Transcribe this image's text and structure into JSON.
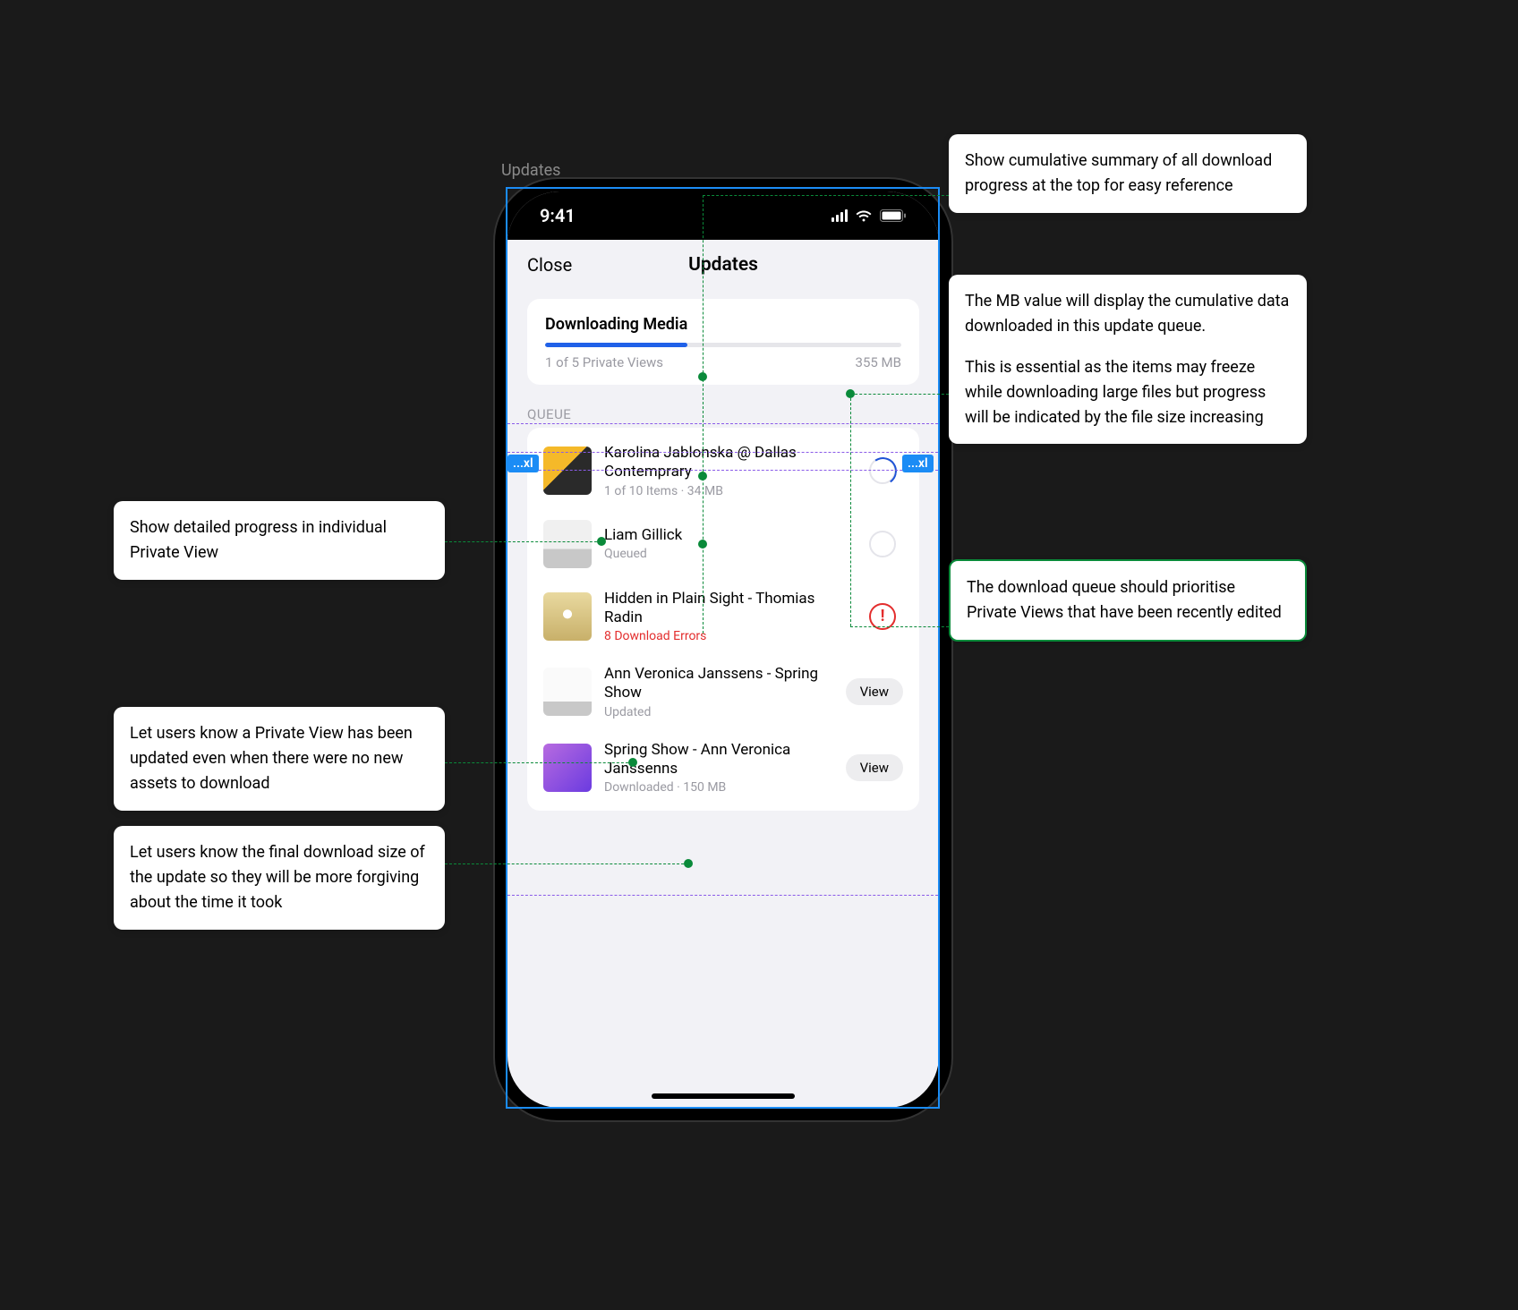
{
  "canvas_label": "Updates",
  "status": {
    "time": "9:41"
  },
  "nav": {
    "close": "Close",
    "title": "Updates"
  },
  "summary": {
    "title": "Downloading Media",
    "views_text": "1 of 5 Private Views",
    "mb_text": "355 MB",
    "progress_pct": 40
  },
  "section": {
    "queue_label": "QUEUE"
  },
  "queue": [
    {
      "title": "Karolina Jablonska @ Dallas Contemprary",
      "sub": "1 of 10 Items · 34 MB",
      "trail": "spinner"
    },
    {
      "title": "Liam Gillick",
      "sub": "Queued",
      "trail": "queued"
    },
    {
      "title": "Hidden in Plain Sight - Thomias Radin",
      "sub": "8 Download Errors",
      "trail": "error",
      "sub_class": "error"
    },
    {
      "title": "Ann Veronica Janssens - Spring Show",
      "sub": "Updated",
      "trail": "view"
    },
    {
      "title": "Spring Show - Ann Veronica Janssenns",
      "sub": "Downloaded · 150 MB",
      "trail": "view"
    }
  ],
  "view_label": "View",
  "xl_left": "...xl",
  "xl_right": "...xl",
  "annotations": {
    "right1": "Show cumulative summary of all download progress at the top for easy reference",
    "right2a": "The MB value will display the cumulative data downloaded in this update queue.",
    "right2b": "This is essential as the items may freeze while downloading large files but progress will be indicated by the file size increasing",
    "right3": "The download queue should prioritise Private Views that have been recently edited",
    "left1": "Show detailed progress in individual Private View",
    "left2": "Let users know a Private View has been updated even when there were no new assets to download",
    "left3": "Let users know the final download size of the update so they will be more forgiving about the time it took"
  }
}
